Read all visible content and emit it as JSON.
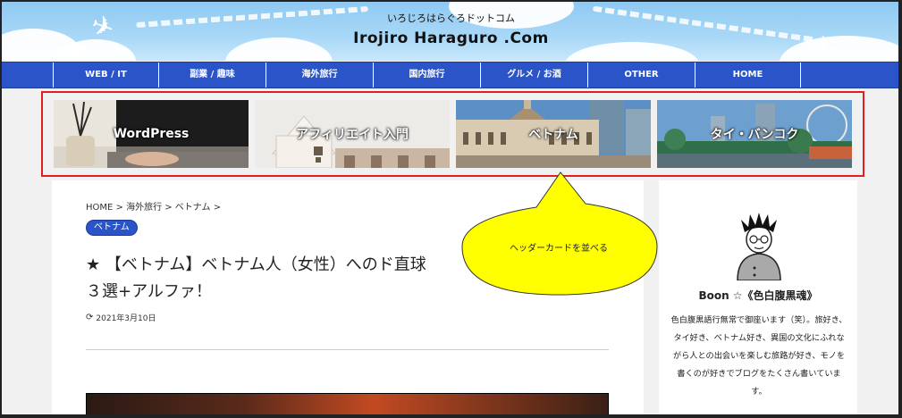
{
  "header": {
    "tagline": "いろじろはらぐろドットコム",
    "title": "Irojiro Haraguro .Com"
  },
  "nav": {
    "items": [
      {
        "label": "WEB / IT"
      },
      {
        "label": "副業 / 趣味"
      },
      {
        "label": "海外旅行"
      },
      {
        "label": "国内旅行"
      },
      {
        "label": "グルメ / お酒"
      },
      {
        "label": "OTHER"
      },
      {
        "label": "HOME"
      }
    ]
  },
  "cards": [
    {
      "label": "WordPress"
    },
    {
      "label": "アフィリエイト入門"
    },
    {
      "label": "ベトナム"
    },
    {
      "label": "タイ・バンコク"
    }
  ],
  "article": {
    "breadcrumb": "HOME > 海外旅行 > ベトナム >",
    "category": "ベトナム",
    "title_line1": "★ 【ベトナム】ベトナム人（女性）へのド直球",
    "title_line2": "３選+アルファ！",
    "date": "2021年3月10日"
  },
  "callout": {
    "text": "ヘッダーカードを並べる",
    "color": "#ffff00"
  },
  "sidebar": {
    "author_name": "Boon ☆《色白腹黒魂》",
    "bio": "色白腹黒語行無常で御座います（笑）。旅好き、タイ好き、ベトナム好き、異国の文化にふれながら人との出会いを楽しむ旅路が好き、モノを書くのが好きでブログをたくさん書いています。"
  },
  "colors": {
    "nav": "#2b54c9",
    "highlight_border": "#e02020",
    "badge": "#2b54c9"
  }
}
